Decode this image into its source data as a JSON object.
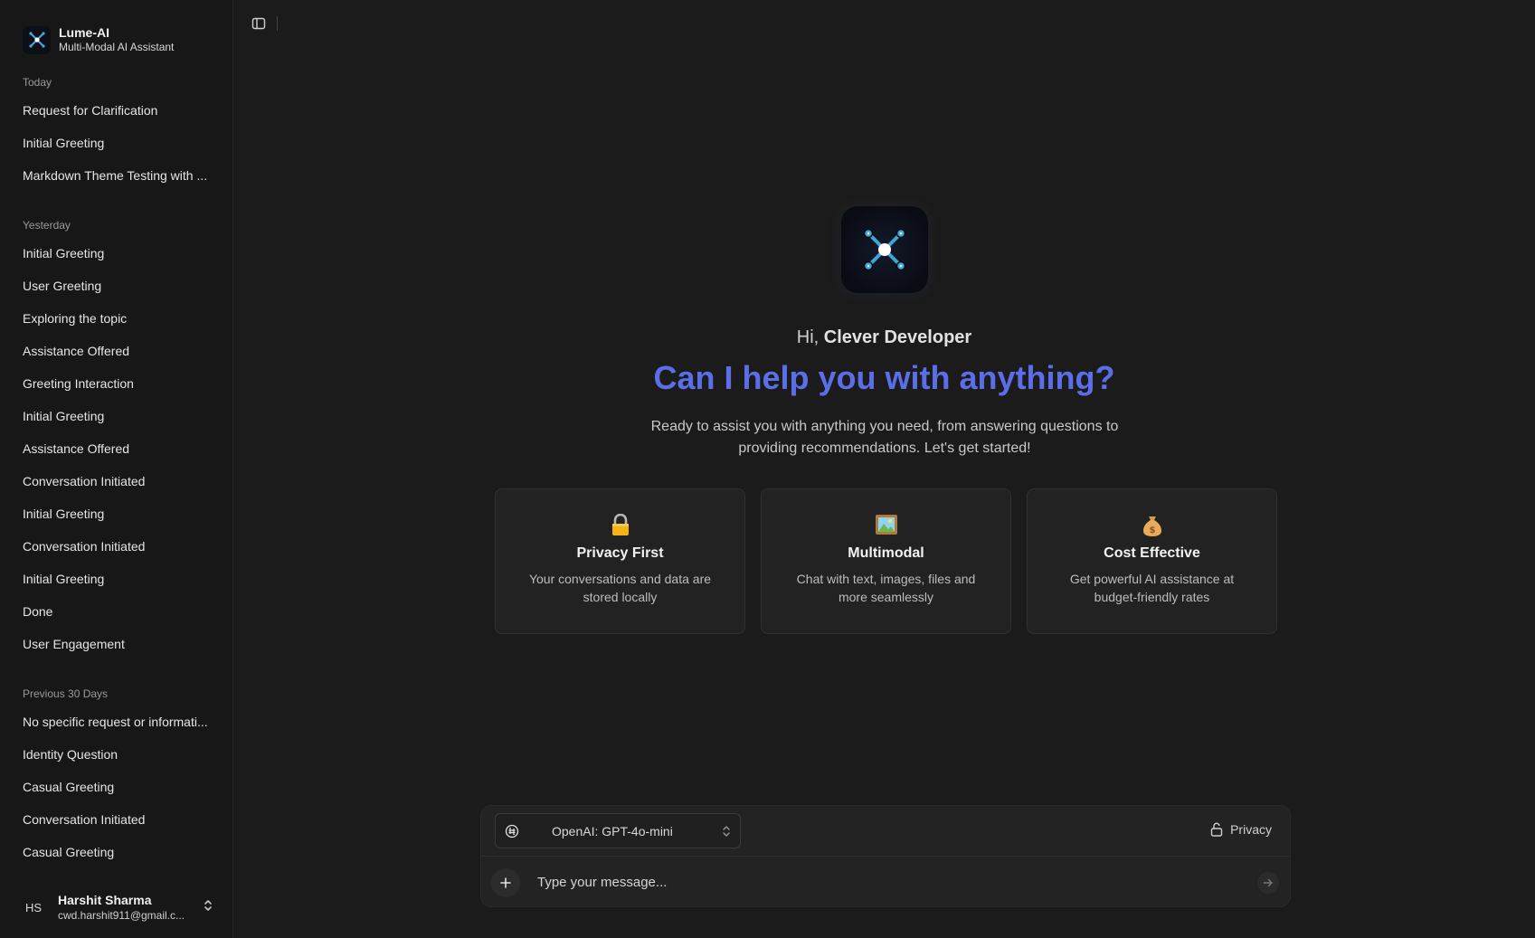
{
  "brand": {
    "title": "Lume-AI",
    "subtitle": "Multi-Modal AI Assistant"
  },
  "history": [
    {
      "label": "Today",
      "items": [
        "Request for Clarification",
        "Initial Greeting",
        "Markdown Theme Testing with ..."
      ]
    },
    {
      "label": "Yesterday",
      "items": [
        "Initial Greeting",
        "User Greeting",
        "Exploring the topic",
        "Assistance Offered",
        "Greeting Interaction",
        "Initial Greeting",
        "Assistance Offered",
        "Conversation Initiated",
        "Initial Greeting",
        "Conversation Initiated",
        "Initial Greeting",
        "Done",
        "User Engagement"
      ]
    },
    {
      "label": "Previous 30 Days",
      "items": [
        "No specific request or informati...",
        "Identity Question",
        "Casual Greeting",
        "Conversation Initiated",
        "Casual Greeting"
      ]
    }
  ],
  "user": {
    "initials": "HS",
    "name": "Harshit Sharma",
    "email": "cwd.harshit911@gmail.c..."
  },
  "hero": {
    "greeting_prefix": "Hi, ",
    "greeting_name": "Clever Developer",
    "headline": "Can I help you with anything?",
    "intro": "Ready to assist you with anything you need, from answering questions to providing recommendations. Let's get started!"
  },
  "cards": [
    {
      "icon": "lock-icon",
      "title": "Privacy First",
      "desc": "Your conversations and data are stored locally"
    },
    {
      "icon": "framed-picture-icon",
      "title": "Multimodal",
      "desc": "Chat with text, images, files and more seamlessly"
    },
    {
      "icon": "money-bag-icon",
      "title": "Cost Effective",
      "desc": "Get powerful AI assistance at budget-friendly rates"
    }
  ],
  "composer": {
    "model": "OpenAI: GPT-4o-mini",
    "privacy_label": "Privacy",
    "placeholder": "Type your message..."
  },
  "colors": {
    "accent": "#5b6ee8",
    "background": "#1b1b1b",
    "sidebar": "#171717",
    "card": "#222222"
  }
}
